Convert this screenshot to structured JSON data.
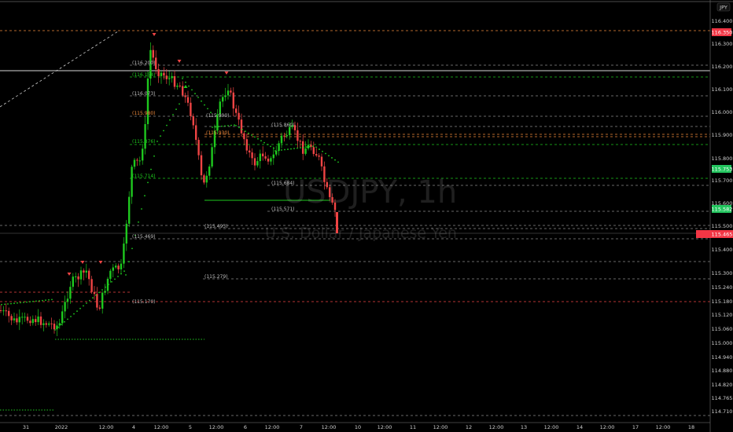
{
  "watermark": {
    "symbol": "USDJPY, 1h",
    "description": "U.S. Dollar / Japanese Yen"
  },
  "currency_label": "JPY",
  "price_axis": {
    "ticks": [
      "116.400",
      "116.300",
      "116.200",
      "116.100",
      "116.000",
      "115.900",
      "115.800",
      "115.700",
      "115.600",
      "115.500",
      "115.400",
      "115.300",
      "115.240",
      "115.180",
      "115.120",
      "115.060",
      "115.000",
      "114.940",
      "114.880",
      "114.820",
      "114.765",
      "114.710"
    ]
  },
  "time_axis": {
    "ticks": [
      "31",
      "2022",
      "12:00",
      "4",
      "12:00",
      "5",
      "12:00",
      "6",
      "12:00",
      "7",
      "12:00",
      "10",
      "12:00",
      "11",
      "12:00",
      "12",
      "12:00",
      "13",
      "12:00",
      "14",
      "12:00",
      "17",
      "12:00",
      "18"
    ]
  },
  "level_labels": [
    "(116.200)",
    "(116.154)",
    "(116.073)",
    "(115.980)",
    "(115.876)",
    "(115.990)",
    "(115.930)",
    "(115.860)",
    "(115.714)",
    "(115.684)",
    "(115.571)",
    "(115.493)",
    "(115.469)",
    "(115.279)",
    "(115.170)"
  ],
  "price_badges": [
    {
      "text": "116.350",
      "color": "#f23645",
      "kind": "level"
    },
    {
      "text": "115.753",
      "color": "#22c55e",
      "kind": "level"
    },
    {
      "text": "115.582",
      "color": "#22c55e",
      "kind": "level"
    },
    {
      "text": "115.465",
      "color": "#f23645",
      "kind": "current"
    }
  ],
  "colors": {
    "up": "#1ec81e",
    "down": "#ef4444",
    "background": "#000000",
    "dashed": "#8a8a8a",
    "orange": "#f08a3c"
  }
}
